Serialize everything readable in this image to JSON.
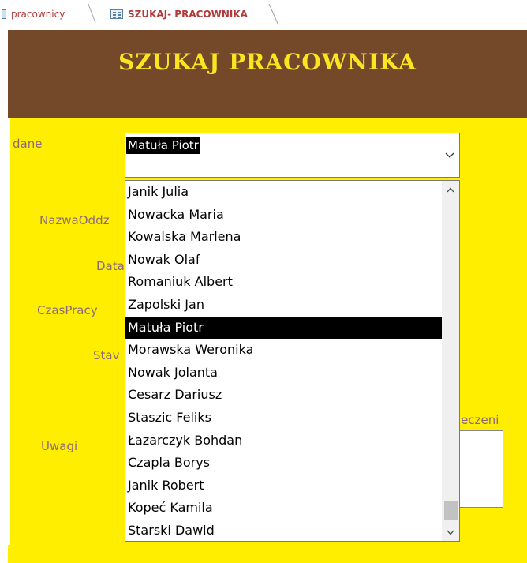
{
  "tabs": [
    {
      "label": "pracownicy",
      "active": false
    },
    {
      "label": "SZUKAJ- PRACOWNIKA",
      "active": true
    }
  ],
  "header": {
    "title": "SZUKAJ PRACOWNIKA"
  },
  "fields": {
    "dane_label": "dane",
    "nazwa_oddz_label": "NazwaOddz",
    "data_label": "Data",
    "czas_pracy_label": "CzasPracy",
    "stav_label": "Stav",
    "ubezpieczeni_label": "ieczeni",
    "uwagi_label": "Uwagi"
  },
  "combo": {
    "selected_value": "Matuła Piotr",
    "items": [
      "Janik Julia",
      "Nowacka Maria",
      "Kowalska Marlena",
      "Nowak Olaf",
      "Romaniuk Albert",
      "Zapolski Jan",
      "Matuła Piotr",
      "Morawska Weronika",
      "Nowak Jolanta",
      "Cesarz Dariusz",
      "Staszic Feliks",
      "Łazarczyk Bohdan",
      "Czapla Borys",
      "Janik Robert",
      "Kopeć Kamila",
      "Starski Dawid"
    ],
    "selected_index": 6
  },
  "colors": {
    "header_bg": "#74492a",
    "title_color": "#fbe521",
    "detail_bg": "#ffee00",
    "tab_text": "#b13a3a"
  }
}
